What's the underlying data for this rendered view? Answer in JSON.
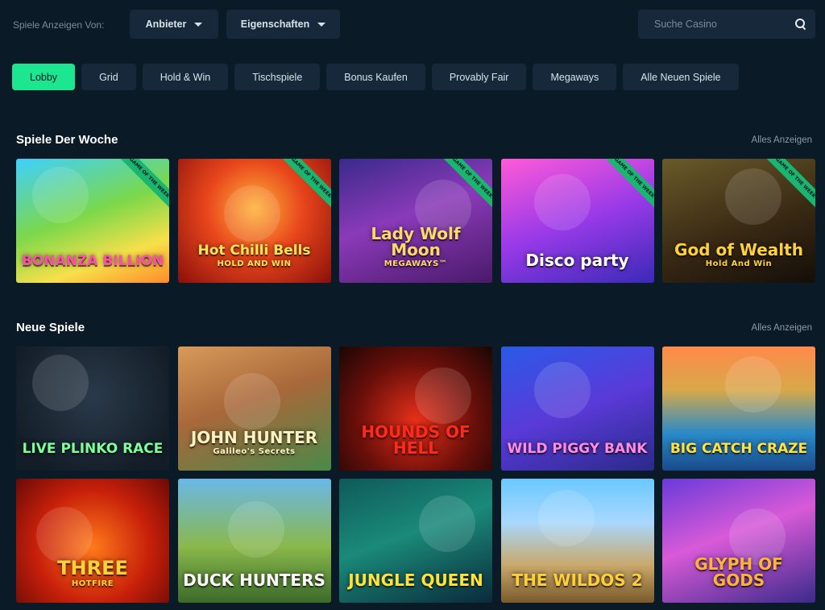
{
  "filter": {
    "label": "Spiele Anzeigen Von:",
    "provider_label": "Anbieter",
    "properties_label": "Eigenschaften",
    "search_placeholder": "Suche Casino"
  },
  "tabs": [
    {
      "label": "Lobby",
      "active": true
    },
    {
      "label": "Grid"
    },
    {
      "label": "Hold & Win"
    },
    {
      "label": "Tischspiele"
    },
    {
      "label": "Bonus Kaufen"
    },
    {
      "label": "Provably Fair"
    },
    {
      "label": "Megaways"
    },
    {
      "label": "Alle Neuen Spiele"
    }
  ],
  "sections": {
    "weekly": {
      "title": "Spiele Der Woche",
      "see_all": "Alles Anzeigen",
      "badge": "GAME OF THE WEEK",
      "games": [
        {
          "title": "BONANZA BILLION",
          "sub": "",
          "bg": "linear-gradient(160deg,#3fd0ff 0%,#7bd84a 45%,#f7e04a 75%,#ff8a2a 100%)",
          "color": "#ff4fae"
        },
        {
          "title": "Hot Chilli Bells",
          "sub": "HOLD AND WIN",
          "bg": "radial-gradient(circle at 50% 40%,#ffb23a 0%,#e8461c 45%,#8a0f0a 100%)",
          "color": "#ffe55a"
        },
        {
          "title": "Lady Wolf Moon",
          "sub": "MEGAWAYS™",
          "bg": "linear-gradient(160deg,#3a2a8a 0%,#8a3ab8 45%,#4a1a6a 100%)",
          "color": "#ffd86a"
        },
        {
          "title": "Disco party",
          "sub": "",
          "bg": "linear-gradient(160deg,#ff5ad8 0%,#9a3ae8 50%,#3a2ab8 100%)",
          "color": "#ffffff"
        },
        {
          "title": "God of Wealth",
          "sub": "Hold And Win",
          "bg": "linear-gradient(160deg,#6a5a2a 0%,#3a2a14 55%,#140e08 100%)",
          "color": "#ffd23a"
        }
      ]
    },
    "new": {
      "title": "Neue Spiele",
      "see_all": "Alles Anzeigen",
      "games": [
        {
          "title": "LIVE PLINKO RACE",
          "sub": "",
          "bg": "radial-gradient(circle at 50% 40%,#2a3a4a 0%,#131d27 80%)",
          "color": "#7dff9a"
        },
        {
          "title": "JOHN HUNTER",
          "sub": "Galileo's Secrets",
          "bg": "linear-gradient(160deg,#d99a5a 0%,#a8683a 45%,#4a8a4a 100%)",
          "color": "#fff2c2"
        },
        {
          "title": "HOUNDS OF HELL",
          "sub": "",
          "bg": "radial-gradient(circle at 50% 60%,#e8301a 0%,#6a0f0a 55%,#1a0604 100%)",
          "color": "#ff2a1a"
        },
        {
          "title": "WILD PIGGY BANK",
          "sub": "",
          "bg": "linear-gradient(160deg,#2a5ae8 0%,#5a3ad8 50%,#2a2a8a 100%)",
          "color": "#ff8ae0"
        },
        {
          "title": "BIG CATCH CRAZE",
          "sub": "",
          "bg": "linear-gradient(180deg,#ff8a4a 0%,#d8a84a 35%,#2a8ac8 70%,#1a4a8a 100%)",
          "color": "#ffe23a"
        },
        {
          "title": "THREE",
          "sub": "HOTFIRE",
          "bg": "radial-gradient(circle at 50% 55%,#ff7a1a 0%,#c8200a 55%,#6a0a06 100%)",
          "color": "#ffd23a"
        },
        {
          "title": "DUCK HUNTERS",
          "sub": "",
          "bg": "linear-gradient(180deg,#6ab8e8 0%,#8ab84a 55%,#3a6a2a 100%)",
          "color": "#ffffff"
        },
        {
          "title": "JUNGLE QUEEN",
          "sub": "",
          "bg": "linear-gradient(160deg,#0f5a5a 0%,#1a8a7a 45%,#0a2a3a 100%)",
          "color": "#ffe23a"
        },
        {
          "title": "THE WILDOS 2",
          "sub": "",
          "bg": "linear-gradient(180deg,#6ac8ff 0%,#a8d8ff 35%,#c8a86a 70%,#7a5a2a 100%)",
          "color": "#ffcf3a"
        },
        {
          "title": "GLYPH OF GODS",
          "sub": "",
          "bg": "linear-gradient(160deg,#6a3ad8 0%,#d85ad8 45%,#3a2a8a 100%)",
          "color": "#ffb23a"
        }
      ]
    }
  },
  "colors": {
    "background": "#0b1a27",
    "surface": "#16283a",
    "accent": "#1ce68f"
  }
}
